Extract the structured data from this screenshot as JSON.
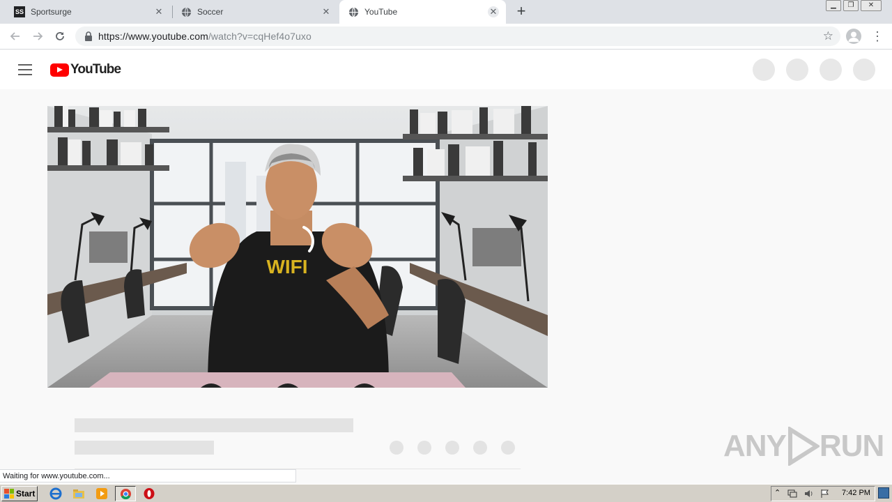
{
  "browser": {
    "tabs": [
      {
        "title": "Sportsurge",
        "icon": "sportsurge-favicon",
        "active": false
      },
      {
        "title": "Soccer",
        "icon": "globe-icon",
        "active": false
      },
      {
        "title": "YouTube",
        "icon": "globe-icon",
        "active": true
      }
    ],
    "new_tab_symbol": "+",
    "url_host": "https://www.youtube.com",
    "url_path": "/watch?v=cqHef4o7uxo",
    "status_text": "Waiting for www.youtube.com..."
  },
  "youtube": {
    "logo_text": "YouTube",
    "video": {
      "shirt_text": "WIFI",
      "loading": true
    }
  },
  "watermark": {
    "left_text": "ANY",
    "right_text": "RUN"
  },
  "taskbar": {
    "start_label": "Start",
    "clock": "7:42 PM",
    "quick_launch": [
      "internet-explorer-icon",
      "explorer-folder-icon",
      "media-player-icon",
      "chrome-icon",
      "opera-icon"
    ]
  },
  "colors": {
    "youtube_red": "#ff0000",
    "tab_strip": "#dee1e6",
    "taskbar": "#d4d0c8"
  }
}
